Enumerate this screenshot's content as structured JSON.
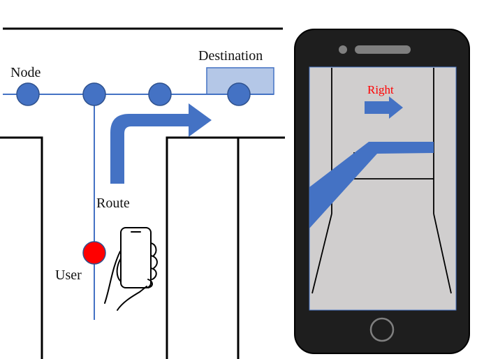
{
  "labels": {
    "node": "Node",
    "destination": "Destination",
    "route": "Route",
    "user": "User"
  },
  "phone_screen": {
    "direction_text": "Right",
    "direction_icon": "right-arrow-icon"
  },
  "icons": {
    "hand_phone": "hand-holding-phone-icon",
    "turn_arrow": "turn-right-arrow-icon",
    "home_button": "home-button-icon",
    "speaker": "speaker-slot-icon",
    "camera": "front-camera-icon"
  },
  "colors": {
    "node_blue": "#4472C4",
    "edge_blue": "#4472C4",
    "user_red": "#FF0000",
    "destination_box": "#B4C7E7",
    "screen_bg": "#D0CECE",
    "right_text": "#FF0000",
    "phone_body": "#1E1E1E"
  }
}
